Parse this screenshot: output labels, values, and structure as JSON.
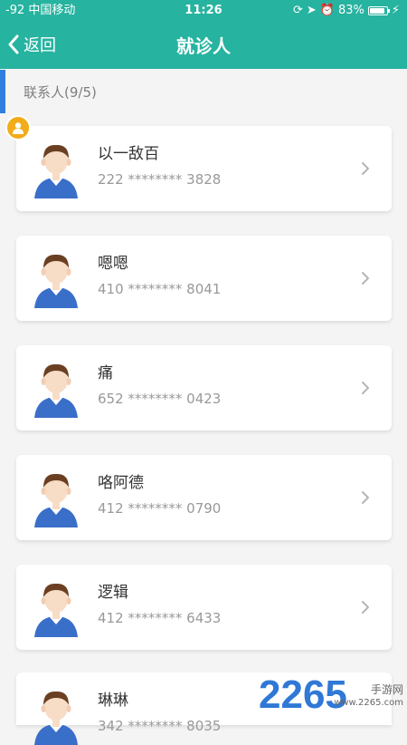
{
  "status_bar": {
    "carrier": "-92 中国移动",
    "time": "11:26",
    "battery_pct": "83%"
  },
  "nav": {
    "back_label": "返回",
    "title": "就诊人"
  },
  "section": {
    "label": "联系人(9/5)"
  },
  "patients": [
    {
      "name": "以一敌百",
      "id": "222 ******** 3828"
    },
    {
      "name": "嗯嗯",
      "id": "410 ******** 8041"
    },
    {
      "name": "痛",
      "id": "652 ******** 0423"
    },
    {
      "name": "咯阿德",
      "id": "412 ******** 0790"
    },
    {
      "name": "逻辑",
      "id": "412 ******** 6433"
    },
    {
      "name": "琳琳",
      "id": "342 ******** 8035"
    }
  ],
  "watermark": {
    "number": "2265",
    "sub": "手游网",
    "url": "www.2265.com"
  },
  "colors": {
    "header": "#26b3a0",
    "accent_bar": "#2f7fe0",
    "owner_badge": "#f2ac1a"
  },
  "icons": {
    "back": "chevron-left-icon",
    "row_arrow": "chevron-right-icon",
    "owner_badge": "person-icon",
    "avatar": "avatar-boy-icon"
  }
}
